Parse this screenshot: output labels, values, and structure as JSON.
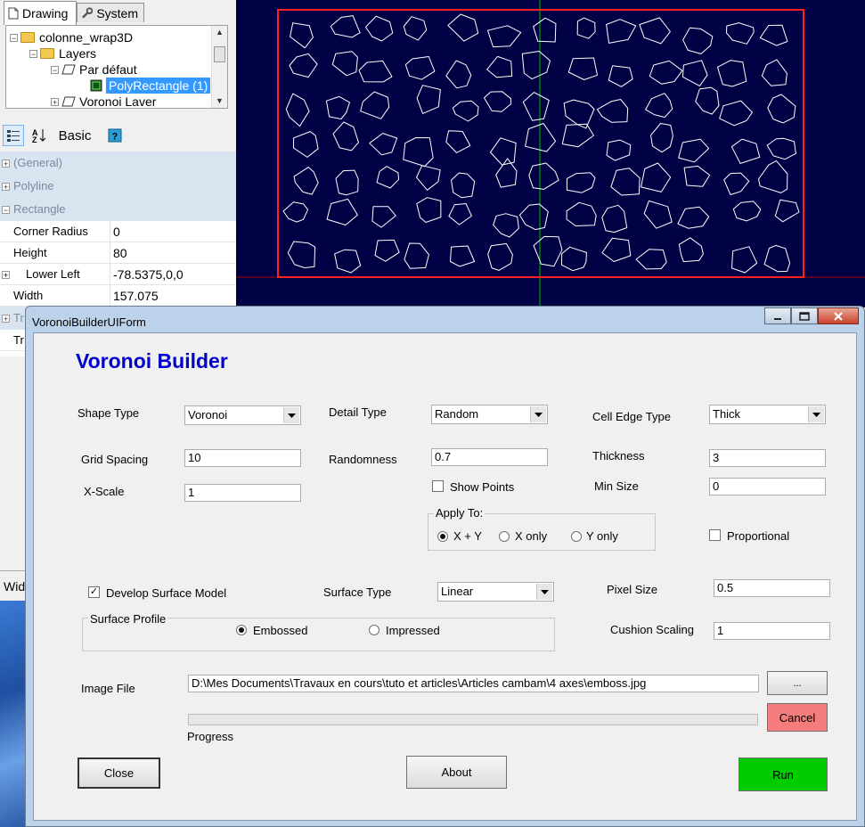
{
  "tabs": [
    {
      "label": "Drawing",
      "active": true
    },
    {
      "label": "System",
      "active": false
    }
  ],
  "tree": {
    "root": "colonne_wrap3D",
    "layers": "Layers",
    "default_layer": "Par défaut",
    "selected_item": "PolyRectangle (1)",
    "voronoi_layer": "Voronoi Laver"
  },
  "property_toolbar": {
    "basic_label": "Basic"
  },
  "property_grid": {
    "categories": [
      "(General)",
      "Polyline",
      "Rectangle"
    ],
    "rows": [
      {
        "name": "Corner Radius",
        "value": "0"
      },
      {
        "name": "Height",
        "value": "80"
      },
      {
        "name": "Lower Left",
        "value": "-78.5375,0,0"
      },
      {
        "name": "Width",
        "value": "157.075"
      }
    ],
    "partial_labels": [
      "Tr",
      "Tr"
    ]
  },
  "canvas": {
    "background": "#000044",
    "rect_color": "#ff0000",
    "cell_color": "#ffffff",
    "axis_color": "#00c000"
  },
  "hidden_tab": "Wid",
  "dialog": {
    "title": "VoronoiBuilderUIForm",
    "heading": "Voronoi Builder",
    "heading_color": "#0000cc",
    "shape_type_label": "Shape Type",
    "shape_type_value": "Voronoi",
    "detail_type_label": "Detail Type",
    "detail_type_value": "Random",
    "cell_edge_type_label": "Cell Edge Type",
    "cell_edge_type_value": "Thick",
    "grid_spacing_label": "Grid Spacing",
    "grid_spacing_value": "10",
    "randomness_label": "Randomness",
    "randomness_value": "0.7",
    "thickness_label": "Thickness",
    "thickness_value": "3",
    "xscale_label": "X-Scale",
    "xscale_value": "1",
    "show_points_label": "Show Points",
    "show_points_checked": false,
    "min_size_label": "Min Size",
    "min_size_value": "0",
    "apply_to_label": "Apply To:",
    "apply_xy": "X + Y",
    "apply_x": "X only",
    "apply_y": "Y only",
    "proportional_label": "Proportional",
    "proportional_checked": false,
    "develop_label": "Develop Surface Model",
    "develop_checked": true,
    "surface_type_label": "Surface Type",
    "surface_type_value": "Linear",
    "pixel_size_label": "Pixel Size",
    "pixel_size_value": "0.5",
    "surface_profile_label": "Surface Profile",
    "embossed_label": "Embossed",
    "impressed_label": "Impressed",
    "cushion_label": "Cushion Scaling",
    "cushion_value": "1",
    "image_file_label": "Image File",
    "image_file_value": "D:\\Mes Documents\\Travaux en cours\\tuto et articles\\Articles cambam\\4 axes\\emboss.jpg",
    "browse_label": "...",
    "cancel_label": "Cancel",
    "cancel_color": "#f47c7c",
    "progress_label": "Progress",
    "progress_value": 0,
    "close_label": "Close",
    "about_label": "About",
    "run_label": "Run",
    "run_color": "#00cc00"
  }
}
